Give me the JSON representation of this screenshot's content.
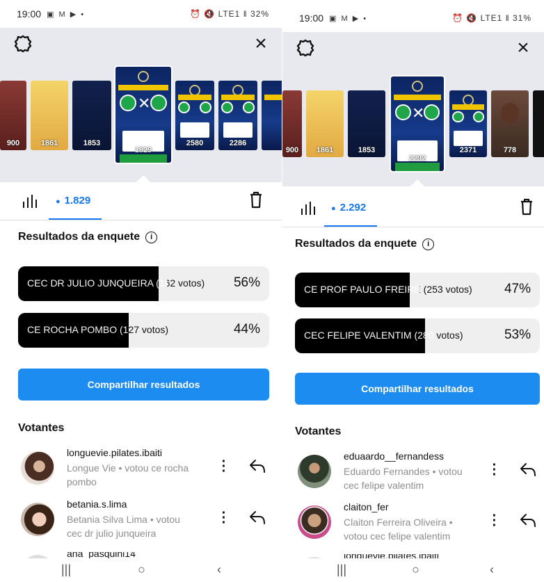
{
  "left": {
    "status": {
      "time": "19:00",
      "notif_icons": "▣ M ▶ •",
      "right": "⏰ 🔇 LTE1 ‖ 32%"
    },
    "thumb_views": [
      "900",
      "1861",
      "1853",
      "1829",
      "2580",
      "2286"
    ],
    "tabs": {
      "views": "1.829"
    },
    "poll_title": "Resultados da enquete",
    "options": [
      {
        "label": "CEC DR JULIO JUNQUEIRA (162 votos)",
        "pct": "56%",
        "fraction": 0.56
      },
      {
        "label": "CE ROCHA POMBO (127 votos)",
        "pct": "44%",
        "fraction": 0.44
      }
    ],
    "share_label": "Compartilhar resultados",
    "voters_title": "Votantes",
    "voters": [
      {
        "username": "longuevie.pilates.ibaiti",
        "desc": "Longue Vie • votou ce rocha pombo"
      },
      {
        "username": "betania.s.lima",
        "desc": "Betania Silva Lima • votou cec dr julio junqueira"
      }
    ],
    "partial_username": "ana_pasquini14"
  },
  "right": {
    "status": {
      "time": "19:00",
      "notif_icons": "▣ M ▶ •",
      "right": "⏰ 🔇 LTE1 ‖ 31%"
    },
    "thumb_views": [
      "900",
      "1861",
      "1853",
      "2292",
      "2371",
      "778"
    ],
    "tabs": {
      "views": "2.292"
    },
    "poll_title": "Resultados da enquete",
    "options": [
      {
        "label": "CE PROF PAULO FREIRE (253 votos)",
        "pct": "47%",
        "fraction": 0.47
      },
      {
        "label": "CEC FELIPE VALENTIM (280 votos)",
        "pct": "53%",
        "fraction": 0.53
      }
    ],
    "share_label": "Compartilhar resultados",
    "voters_title": "Votantes",
    "voters": [
      {
        "username": "eduaardo__fernandess",
        "desc": "Eduardo Fernandes • votou cec felipe valentim"
      },
      {
        "username": "claiton_fer",
        "desc": "Claiton Ferreira Oliveira • votou cec felipe valentim"
      }
    ],
    "partial_username": "longuevie.pilates.ibaiti"
  },
  "nav": {
    "recents": "|||",
    "home": "○",
    "back": "‹"
  },
  "colors": {
    "accent": "#1778f2",
    "share_button": "#1d8cf0",
    "poll_fill": "#000000",
    "poll_track": "#efefef"
  },
  "icons": [
    "settings-icon",
    "close-icon",
    "insights-icon",
    "eye-icon",
    "trash-icon",
    "info-icon",
    "more-icon",
    "reply-icon"
  ]
}
